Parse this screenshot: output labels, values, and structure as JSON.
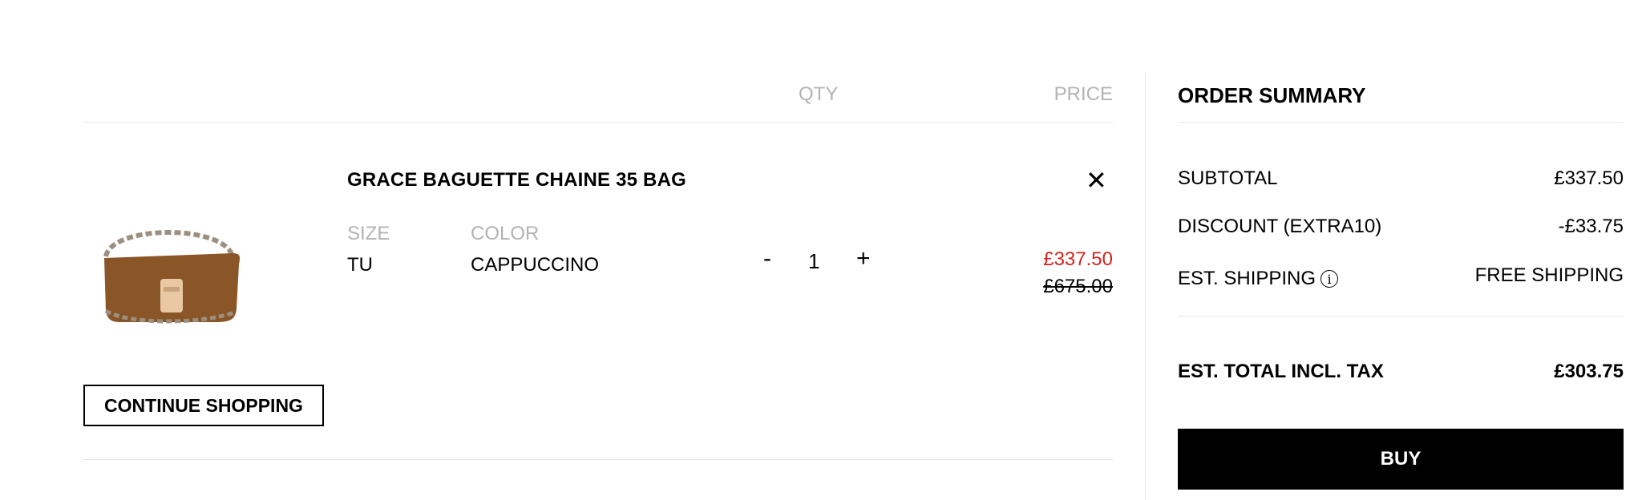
{
  "cart": {
    "headers": {
      "qty": "QTY",
      "price": "PRICE"
    },
    "item": {
      "name": "GRACE BAGUETTE CHAINE 35 BAG",
      "remove_icon": "close-icon",
      "size_label": "SIZE",
      "size_value": "TU",
      "color_label": "COLOR",
      "color_value": "CAPPUCCINO",
      "qty_minus": "-",
      "qty_value": "1",
      "qty_plus": "+",
      "sale_price": "£337.50",
      "original_price": "£675.00",
      "image_colors": {
        "leather": "#8a5527",
        "clasp": "#e8c9a4",
        "chain": "#9c8f80"
      }
    },
    "continue_label": "CONTINUE SHOPPING"
  },
  "summary": {
    "title": "ORDER SUMMARY",
    "subtotal_label": "SUBTOTAL",
    "subtotal_value": "£337.50",
    "discount_label": "DISCOUNT (EXTRA10)",
    "discount_value": "-£33.75",
    "shipping_label": "EST. SHIPPING",
    "shipping_info_icon": "info-icon",
    "shipping_value": "FREE SHIPPING",
    "total_label": "EST. TOTAL INCL. TAX",
    "total_value": "£303.75",
    "buy_label": "BUY"
  },
  "colors": {
    "sale_red": "#d0251c",
    "muted_gray": "#b3b3b3",
    "divider": "#e6e6e6"
  }
}
